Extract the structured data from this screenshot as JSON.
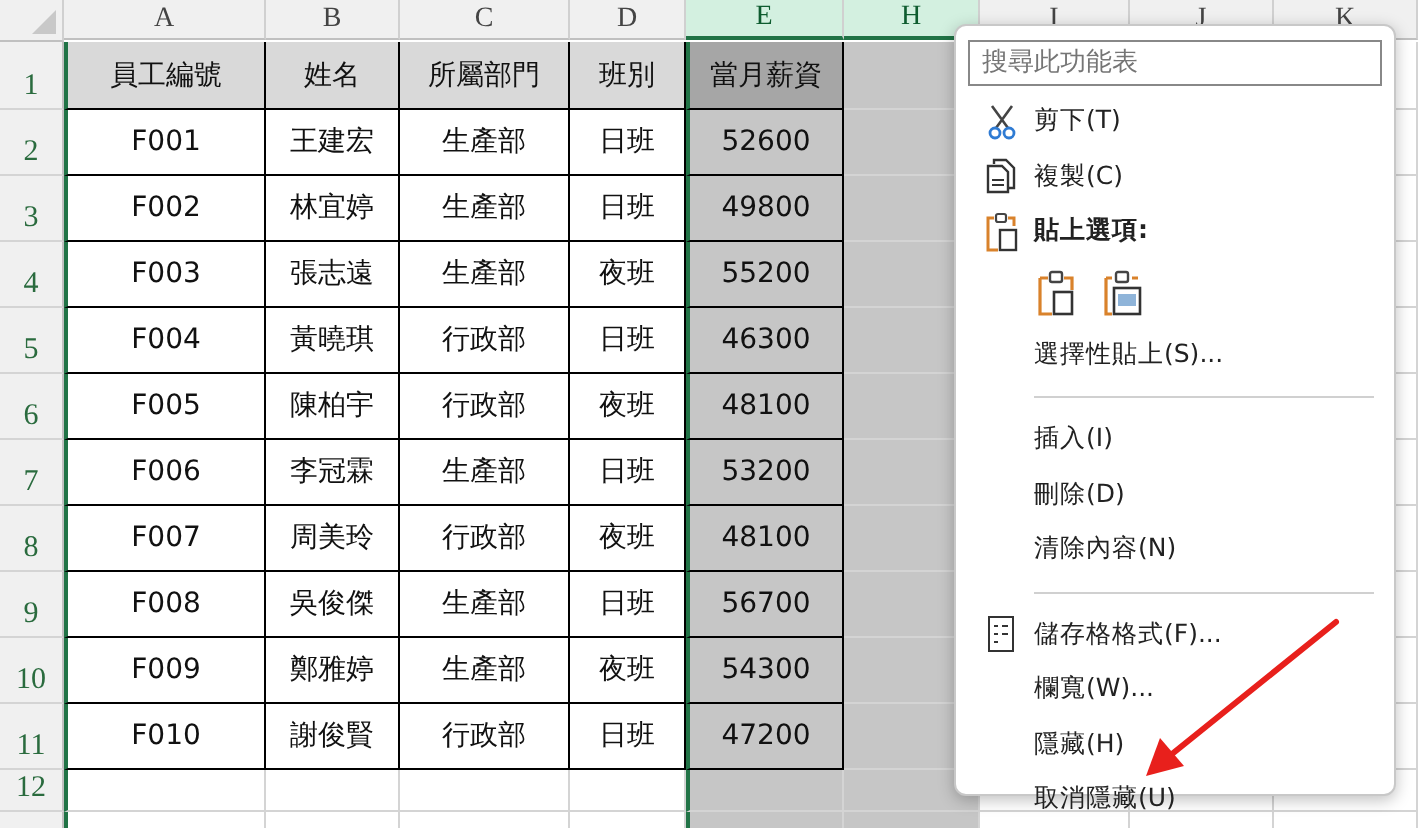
{
  "columns": [
    {
      "label": "A",
      "selected": false
    },
    {
      "label": "B",
      "selected": false
    },
    {
      "label": "C",
      "selected": false
    },
    {
      "label": "D",
      "selected": false
    },
    {
      "label": "E",
      "selected": true
    },
    {
      "label": "H",
      "selected": true
    },
    {
      "label": "I",
      "selected": false
    },
    {
      "label": "J",
      "selected": false
    },
    {
      "label": "K",
      "selected": false
    }
  ],
  "row_numbers": [
    "1",
    "2",
    "3",
    "4",
    "5",
    "6",
    "7",
    "8",
    "9",
    "10",
    "11",
    "12"
  ],
  "rows": [
    [
      "員工編號",
      "姓名",
      "所屬部門",
      "班別",
      "當月薪資"
    ],
    [
      "F001",
      "王建宏",
      "生產部",
      "日班",
      "52600"
    ],
    [
      "F002",
      "林宜婷",
      "生產部",
      "日班",
      "49800"
    ],
    [
      "F003",
      "張志遠",
      "生產部",
      "夜班",
      "55200"
    ],
    [
      "F004",
      "黃曉琪",
      "行政部",
      "日班",
      "46300"
    ],
    [
      "F005",
      "陳柏宇",
      "行政部",
      "夜班",
      "48100"
    ],
    [
      "F006",
      "李冠霖",
      "生產部",
      "日班",
      "53200"
    ],
    [
      "F007",
      "周美玲",
      "行政部",
      "夜班",
      "48100"
    ],
    [
      "F008",
      "吳俊傑",
      "生產部",
      "日班",
      "56700"
    ],
    [
      "F009",
      "鄭雅婷",
      "生產部",
      "夜班",
      "54300"
    ],
    [
      "F010",
      "謝俊賢",
      "行政部",
      "日班",
      "47200"
    ]
  ],
  "context_menu": {
    "search": {
      "placeholder": "搜尋此功能表"
    },
    "items": [
      {
        "kind": "cut",
        "label": "剪下(T)"
      },
      {
        "kind": "copy",
        "label": "複製(C)"
      },
      {
        "kind": "paste-header",
        "label": "貼上選項:"
      },
      {
        "kind": "paste-options"
      },
      {
        "kind": "plain",
        "label": "選擇性貼上(S)..."
      },
      {
        "kind": "separator"
      },
      {
        "kind": "plain",
        "label": "插入(I)"
      },
      {
        "kind": "plain",
        "label": "刪除(D)"
      },
      {
        "kind": "plain",
        "label": "清除內容(N)"
      },
      {
        "kind": "separator"
      },
      {
        "kind": "format",
        "label": "儲存格格式(F)..."
      },
      {
        "kind": "plain",
        "label": "欄寬(W)..."
      },
      {
        "kind": "plain",
        "label": "隱藏(H)"
      },
      {
        "kind": "plain",
        "label": "取消隱藏(U)"
      }
    ]
  }
}
